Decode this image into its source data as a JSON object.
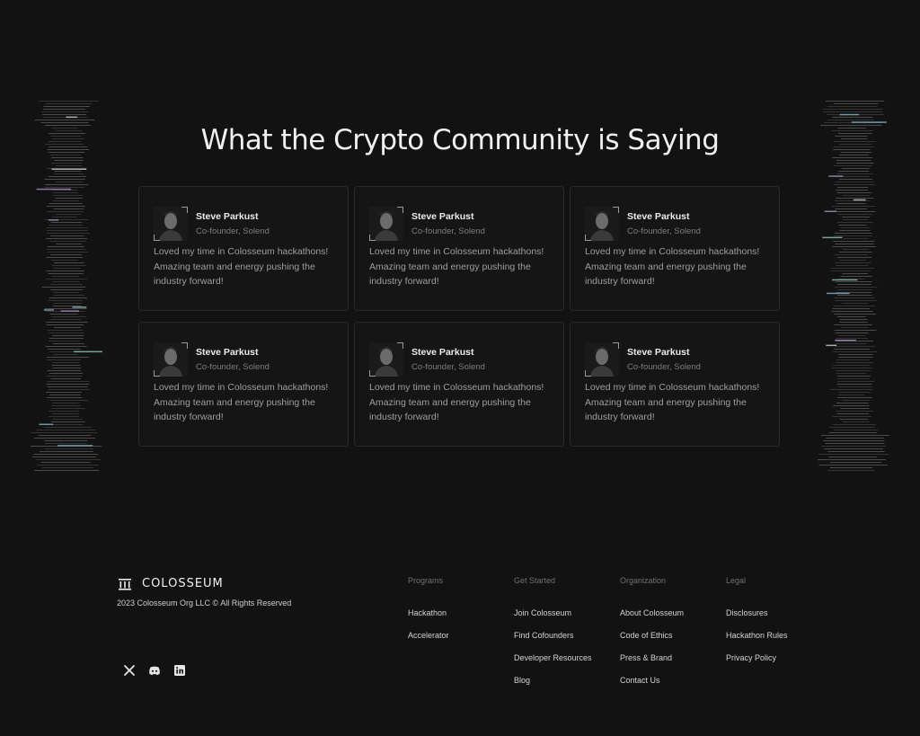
{
  "section": {
    "title": "What the Crypto Community is Saying"
  },
  "testimonials": [
    {
      "name": "Steve Parkust",
      "role": "Co-founder, Solend",
      "quote": "Loved my time in Colosseum hackathons! Amazing team and energy pushing the industry forward!"
    },
    {
      "name": "Steve Parkust",
      "role": "Co-founder, Solend",
      "quote": "Loved my time in Colosseum hackathons! Amazing team and energy pushing the industry forward!"
    },
    {
      "name": "Steve Parkust",
      "role": "Co-founder, Solend",
      "quote": "Loved my time in Colosseum hackathons! Amazing team and energy pushing the industry forward!"
    },
    {
      "name": "Steve Parkust",
      "role": "Co-founder, Solend",
      "quote": "Loved my time in Colosseum hackathons! Amazing team and energy pushing the industry forward!"
    },
    {
      "name": "Steve Parkust",
      "role": "Co-founder, Solend",
      "quote": "Loved my time in Colosseum hackathons! Amazing team and energy pushing the industry forward!"
    },
    {
      "name": "Steve Parkust",
      "role": "Co-founder, Solend",
      "quote": "Loved my time in Colosseum hackathons! Amazing team and energy pushing the industry forward!"
    }
  ],
  "footer": {
    "brand": "COLOSSEUM",
    "copyright": "2023 Colosseum Org LLC © All Rights Reserved",
    "socials": [
      "x-icon",
      "discord-icon",
      "linkedin-icon"
    ],
    "columns": [
      {
        "heading": "Programs",
        "links": [
          "Hackathon",
          "Accelerator"
        ]
      },
      {
        "heading": "Get Started",
        "links": [
          "Join Colosseum",
          "Find Cofounders",
          "Developer Resources",
          "Blog"
        ]
      },
      {
        "heading": "Organization",
        "links": [
          "About Colosseum",
          "Code of Ethics",
          "Press & Brand",
          "Contact Us"
        ]
      },
      {
        "heading": "Legal",
        "links": [
          "Disclosures",
          "Hackathon Rules",
          "Privacy Policy"
        ]
      }
    ]
  },
  "colors": {
    "background": "#121212",
    "card_border": "#2a2a2a",
    "text_primary": "#f0f0f0",
    "text_muted": "#9e9e9e"
  }
}
